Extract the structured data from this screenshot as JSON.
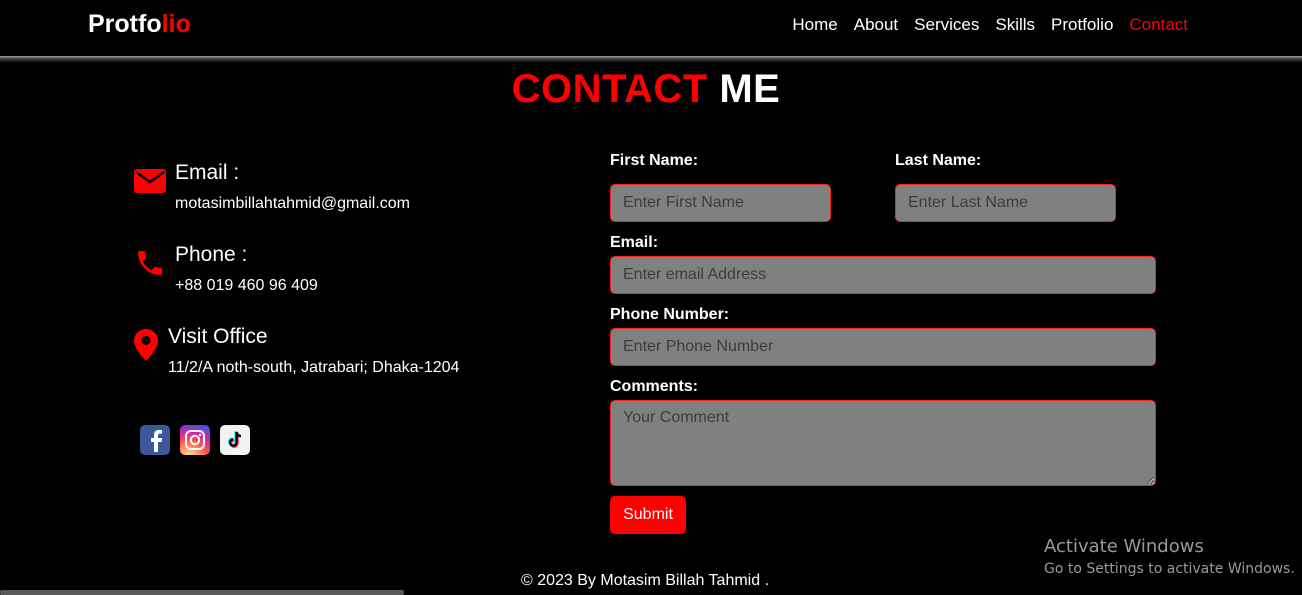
{
  "brand": {
    "main": "Protfo",
    "accent": "lio"
  },
  "nav": [
    {
      "label": "Home",
      "active": false
    },
    {
      "label": "About",
      "active": false
    },
    {
      "label": "Services",
      "active": false
    },
    {
      "label": "Skills",
      "active": false
    },
    {
      "label": "Protfolio",
      "active": false
    },
    {
      "label": "Contact",
      "active": true
    }
  ],
  "heading": {
    "red": "CONTACT",
    "white": "ME"
  },
  "contact": {
    "email": {
      "title": "Email :",
      "value": "motasimbillahtahmid@gmail.com",
      "icon": "envelope-icon"
    },
    "phone": {
      "title": "Phone :",
      "value": "+88 019 460 96 409",
      "icon": "phone-icon"
    },
    "office": {
      "title": "Visit Office",
      "value": "11/2/A noth-south, Jatrabari; Dhaka-1204",
      "icon": "map-pin-icon"
    }
  },
  "social": [
    {
      "icon": "facebook-icon"
    },
    {
      "icon": "instagram-icon"
    },
    {
      "icon": "tiktok-icon"
    }
  ],
  "form": {
    "first_name": {
      "label": "First Name:",
      "placeholder": "Enter First Name"
    },
    "last_name": {
      "label": "Last Name:",
      "placeholder": "Enter Last Name"
    },
    "email": {
      "label": "Email:",
      "placeholder": "Enter email Address"
    },
    "phone": {
      "label": "Phone Number:",
      "placeholder": "Enter Phone Number"
    },
    "comments": {
      "label": "Comments:",
      "placeholder": "Your Comment"
    },
    "submit": "Submit"
  },
  "footer": "© 2023 By Motasim Billah Tahmid .",
  "watermark": {
    "title": "Activate Windows",
    "subtitle": "Go to Settings to activate Windows."
  },
  "colors": {
    "accent": "#ff0000",
    "background": "#000000",
    "field_bg": "#808080"
  }
}
